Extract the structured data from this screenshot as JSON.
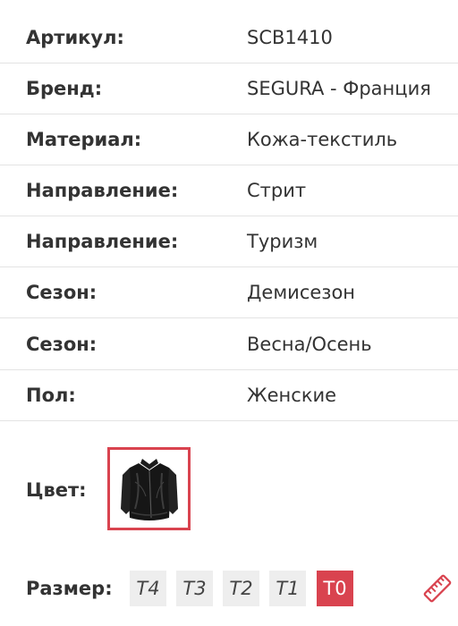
{
  "specs": [
    {
      "label": "Артикул:",
      "value": "SCB1410"
    },
    {
      "label": "Бренд:",
      "value": "SEGURA - Франция"
    },
    {
      "label": "Материал:",
      "value": "Кожа-текстиль"
    },
    {
      "label": "Направление:",
      "value": "Стрит"
    },
    {
      "label": "Направление:",
      "value": "Туризм"
    },
    {
      "label": "Сезон:",
      "value": "Демисезон"
    },
    {
      "label": "Сезон:",
      "value": "Весна/Осень"
    },
    {
      "label": "Пол:",
      "value": "Женские"
    }
  ],
  "color": {
    "label": "Цвет:",
    "swatch_icon": "black-leather-jacket-thumbnail",
    "selected_border_color": "#d9434f"
  },
  "size": {
    "label": "Размер:",
    "options": [
      "T4",
      "T3",
      "T2",
      "T1",
      "T0"
    ],
    "selected": "T0",
    "guide_icon": "ruler-icon"
  },
  "colors": {
    "accent": "#d9434f",
    "chip_bg": "#eeeeee",
    "text": "#333333",
    "divider": "#e3e3e3"
  }
}
